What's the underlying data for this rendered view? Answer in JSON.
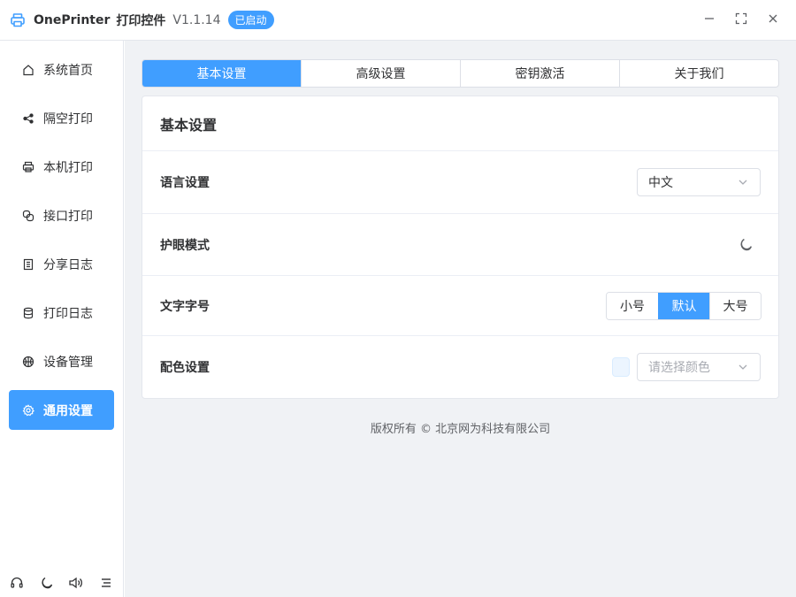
{
  "titlebar": {
    "app_name": "OnePrinter",
    "app_sub": "打印控件",
    "version": "V1.1.14",
    "status": "已启动",
    "icons": [
      "printer-icon",
      "minimize-icon",
      "maximize-icon",
      "close-icon"
    ]
  },
  "sidebar": {
    "items": [
      {
        "label": "系统首页",
        "icon": "home-icon"
      },
      {
        "label": "隔空打印",
        "icon": "share-icon"
      },
      {
        "label": "本机打印",
        "icon": "printer-icon"
      },
      {
        "label": "接口打印",
        "icon": "link-icon"
      },
      {
        "label": "分享日志",
        "icon": "document-icon"
      },
      {
        "label": "打印日志",
        "icon": "database-icon"
      },
      {
        "label": "设备管理",
        "icon": "basketball-icon"
      },
      {
        "label": "通用设置",
        "icon": "gear-icon",
        "active": true
      }
    ],
    "footer_icons": [
      "headset-icon",
      "moon-icon",
      "volume-icon",
      "menu-icon"
    ]
  },
  "tabs": [
    {
      "label": "基本设置",
      "active": true
    },
    {
      "label": "高级设置"
    },
    {
      "label": "密钥激活"
    },
    {
      "label": "关于我们"
    }
  ],
  "card": {
    "title": "基本设置",
    "language": {
      "label": "语言设置",
      "value": "中文"
    },
    "eye_mode": {
      "label": "护眼模式",
      "icon": "moon-icon"
    },
    "font_size": {
      "label": "文字字号",
      "options": [
        "小号",
        "默认",
        "大号"
      ],
      "selected": "默认"
    },
    "color": {
      "label": "配色设置",
      "placeholder": "请选择颜色"
    }
  },
  "footer": {
    "copyright": "版权所有 ©  北京网为科技有限公司"
  },
  "colors": {
    "accent": "#409eff",
    "background": "#f0f2f5"
  }
}
